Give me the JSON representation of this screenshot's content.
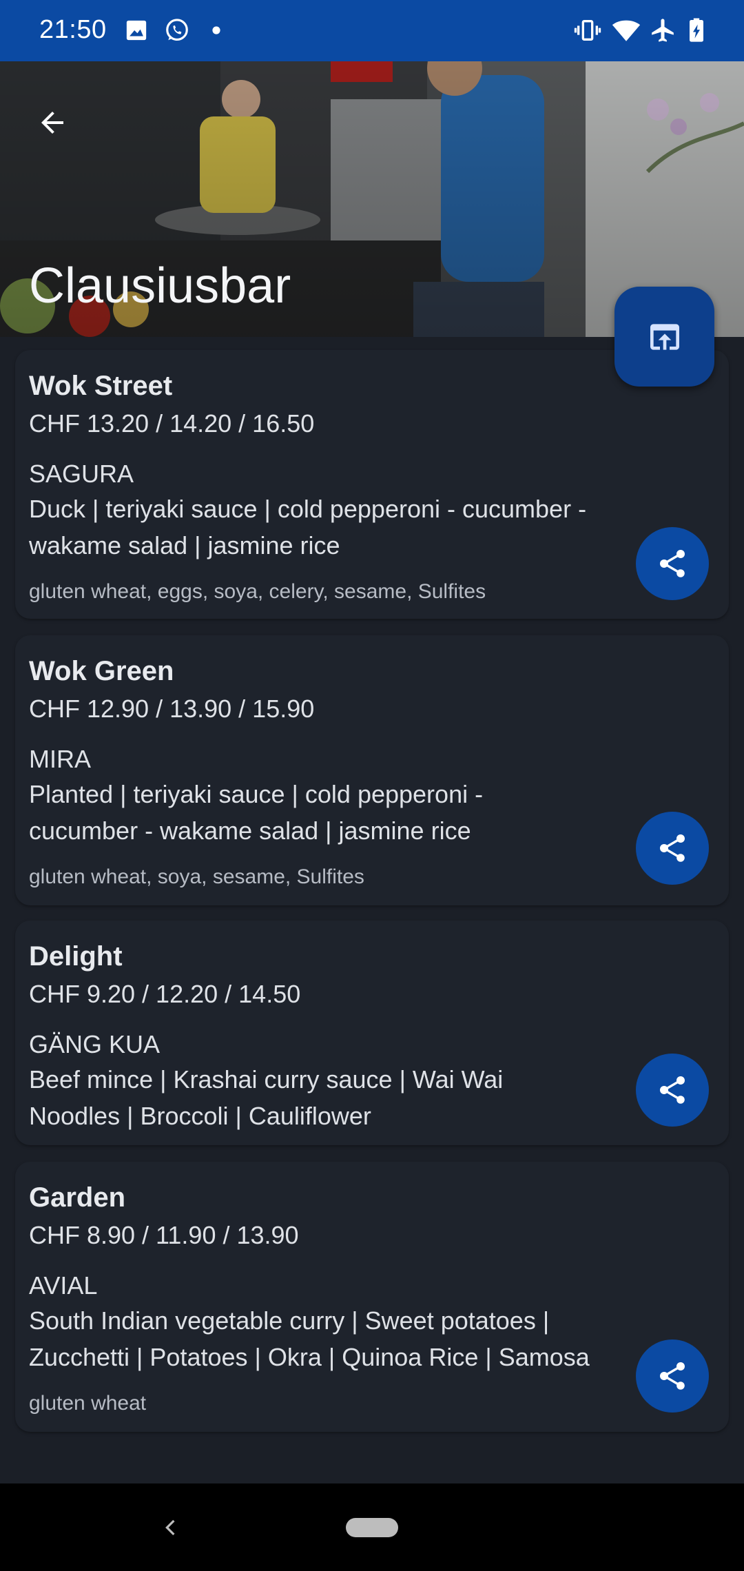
{
  "status_bar": {
    "time": "21:50",
    "icons": [
      "image-icon",
      "whatsapp-icon",
      "dot-icon",
      "vibrate-icon",
      "wifi-icon",
      "airplane-icon",
      "battery-charging-icon"
    ]
  },
  "header": {
    "title": "Clausiusbar",
    "back_icon": "arrow-left-icon",
    "open_icon": "open-in-browser-icon"
  },
  "menu": [
    {
      "name": "Wok Street",
      "price": "CHF 13.20 / 14.20 / 16.50",
      "dish": "SAGURA",
      "description": "Duck | teriyaki sauce | cold pepperoni - cucumber - wakame salad | jasmine rice",
      "allergens": "gluten wheat, eggs, soya, celery, sesame, Sulfites"
    },
    {
      "name": "Wok Green",
      "price": "CHF 12.90 / 13.90 / 15.90",
      "dish": "MIRA",
      "description": "Planted | teriyaki sauce | cold pepperoni - cucumber - wakame salad | jasmine rice",
      "allergens": "gluten wheat, soya, sesame, Sulfites"
    },
    {
      "name": "Delight",
      "price": "CHF 9.20 / 12.20 / 14.50",
      "dish": "GÄNG KUA",
      "description": "Beef mince | Krashai curry sauce | Wai Wai Noodles | Broccoli | Cauliflower",
      "allergens": ""
    },
    {
      "name": "Garden",
      "price": "CHF 8.90 / 11.90 / 13.90",
      "dish": "AVIAL",
      "description": "South Indian vegetable curry | Sweet potatoes | Zucchetti | Potatoes | Okra | Quinoa Rice | Samosa",
      "allergens": "gluten wheat"
    }
  ],
  "colors": {
    "status_bar": "#0b4aa3",
    "background": "#1b1f27",
    "card": "#1e232c",
    "accent": "#0b4aa3",
    "fab": "#0d3f8c"
  }
}
